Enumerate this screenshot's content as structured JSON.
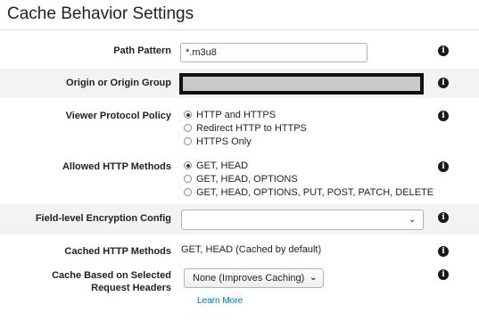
{
  "page": {
    "title": "Cache Behavior Settings"
  },
  "path_pattern": {
    "label": "Path Pattern",
    "value": "*.m3u8",
    "info_icon": "info-icon"
  },
  "origin": {
    "label": "Origin or Origin Group",
    "value": "",
    "info_icon": "info-icon"
  },
  "viewer_protocol_policy": {
    "label": "Viewer Protocol Policy",
    "options": [
      "HTTP and HTTPS",
      "Redirect HTTP to HTTPS",
      "HTTPS Only"
    ],
    "selected": "HTTP and HTTPS"
  },
  "allowed_http_methods": {
    "label": "Allowed HTTP Methods",
    "options": [
      "GET, HEAD",
      "GET, HEAD, OPTIONS",
      "GET, HEAD, OPTIONS, PUT, POST, PATCH, DELETE"
    ],
    "selected": "GET, HEAD"
  },
  "field_level_encryption": {
    "label": "Field-level Encryption Config",
    "value": "",
    "chevron_icon": "chevron-down-icon"
  },
  "cached_http_methods": {
    "label": "Cached HTTP Methods",
    "value": "GET, HEAD (Cached by default)"
  },
  "cache_headers": {
    "label_line1": "Cache Based on Selected",
    "label_line2": "Request Headers",
    "selected": "None (Improves Caching)",
    "learn_more": "Learn More"
  },
  "colors": {
    "band": "#f2f3f3",
    "link": "#0073bb",
    "border": "#aab7b8"
  }
}
